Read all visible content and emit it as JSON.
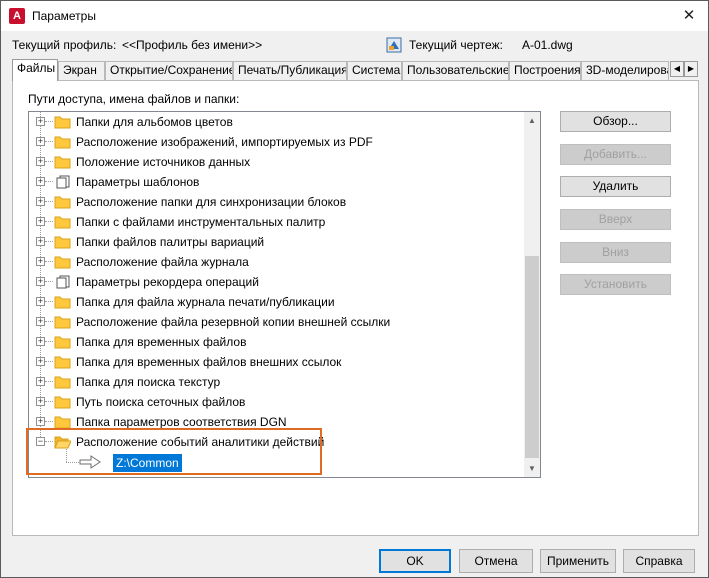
{
  "window": {
    "title": "Параметры",
    "app_icon_letter": "A",
    "close_glyph": "✕"
  },
  "profile": {
    "label": "Текущий профиль:",
    "value": "<<Профиль без имени>>",
    "drawing_label": "Текущий чертеж:",
    "drawing_value": "A-01.dwg"
  },
  "tabs": [
    {
      "label": "Файлы",
      "active": true
    },
    {
      "label": "Экран"
    },
    {
      "label": "Открытие/Сохранение"
    },
    {
      "label": "Печать/Публикация"
    },
    {
      "label": "Система"
    },
    {
      "label": "Пользовательские"
    },
    {
      "label": "Построения"
    },
    {
      "label": "3D-моделирова"
    }
  ],
  "tab_scroll": {
    "left": "◀",
    "right": "▶"
  },
  "paths_label": "Пути доступа, имена файлов и папки:",
  "tree": {
    "items": [
      {
        "label": "Папки для альбомов цветов",
        "icon": "folder-icon",
        "expander": "+"
      },
      {
        "label": "Расположение изображений, импортируемых из PDF",
        "icon": "folder-icon",
        "expander": "+"
      },
      {
        "label": "Положение источников данных",
        "icon": "folder-icon",
        "expander": "+"
      },
      {
        "label": "Параметры шаблонов",
        "icon": "documents-icon",
        "expander": "+"
      },
      {
        "label": "Расположение папки для синхронизации блоков",
        "icon": "folder-icon",
        "expander": "+"
      },
      {
        "label": "Папки с файлами инструментальных палитр",
        "icon": "folder-icon",
        "expander": "+"
      },
      {
        "label": "Папки файлов палитры вариаций",
        "icon": "folder-icon",
        "expander": "+"
      },
      {
        "label": "Расположение файла журнала",
        "icon": "folder-icon",
        "expander": "+"
      },
      {
        "label": "Параметры рекордера операций",
        "icon": "documents-icon",
        "expander": "+"
      },
      {
        "label": "Папка для файла журнала печати/публикации",
        "icon": "folder-icon",
        "expander": "+"
      },
      {
        "label": "Расположение файла резервной копии внешней ссылки",
        "icon": "folder-icon",
        "expander": "+"
      },
      {
        "label": "Папка для временных файлов",
        "icon": "folder-icon",
        "expander": "+"
      },
      {
        "label": "Папка для временных файлов внешних ссылок",
        "icon": "folder-icon",
        "expander": "+"
      },
      {
        "label": "Папка для поиска текстур",
        "icon": "folder-icon",
        "expander": "+"
      },
      {
        "label": "Путь поиска сеточных файлов",
        "icon": "folder-icon",
        "expander": "+"
      },
      {
        "label": "Папка параметров соответствия DGN",
        "icon": "folder-icon",
        "expander": "+"
      },
      {
        "label": "Расположение событий аналитики действий",
        "icon": "open-folder-icon",
        "expander": "−"
      }
    ],
    "child_value": "Z:\\Common"
  },
  "side_buttons": [
    {
      "label": "Обзор...",
      "enabled": true
    },
    {
      "label": "Добавить...",
      "enabled": false
    },
    {
      "label": "Удалить",
      "enabled": true
    },
    {
      "label": "Вверх",
      "enabled": false
    },
    {
      "label": "Вниз",
      "enabled": false
    },
    {
      "label": "Установить",
      "enabled": false
    }
  ],
  "bottom_buttons": {
    "ok": "OK",
    "cancel": "Отмена",
    "apply": "Применить",
    "help": "Справка"
  },
  "colors": {
    "selection": "#0078d7",
    "highlight_box": "#e06c24",
    "folder": "#ffc83d"
  }
}
